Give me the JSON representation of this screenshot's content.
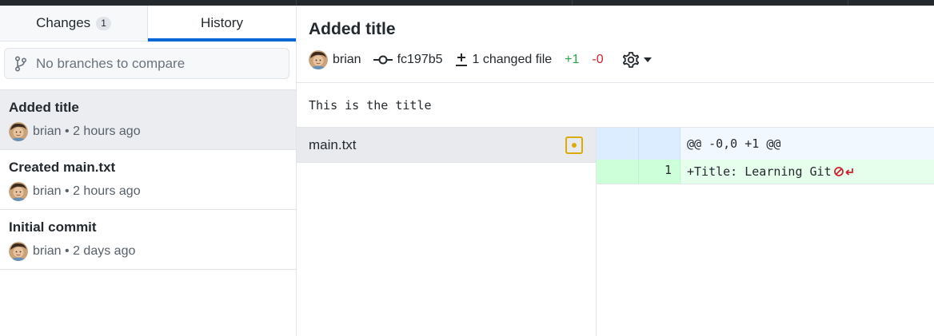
{
  "tabs": {
    "changes_label": "Changes",
    "changes_count": "1",
    "history_label": "History"
  },
  "compare": {
    "placeholder": "No branches to compare"
  },
  "commits": [
    {
      "title": "Added title",
      "author": "brian",
      "time": "2 hours ago",
      "selected": true
    },
    {
      "title": "Created main.txt",
      "author": "brian",
      "time": "2 hours ago",
      "selected": false
    },
    {
      "title": "Initial commit",
      "author": "brian",
      "time": "2 days ago",
      "selected": false
    }
  ],
  "detail": {
    "title": "Added title",
    "author": "brian",
    "sha": "fc197b5",
    "changed_files": "1 changed file",
    "additions": "+1",
    "deletions": "-0",
    "description": "This is the title"
  },
  "files": [
    {
      "name": "main.txt",
      "status": "modified"
    }
  ],
  "diff": {
    "hunk_header": "@@ -0,0 +1 @@",
    "lines": [
      {
        "new_line_number": "1",
        "content": "+Title: Learning Git"
      }
    ]
  },
  "colors": {
    "accent": "#0366d6",
    "addition": "#28a745",
    "deletion": "#cb2431",
    "modified": "#dbab09"
  }
}
